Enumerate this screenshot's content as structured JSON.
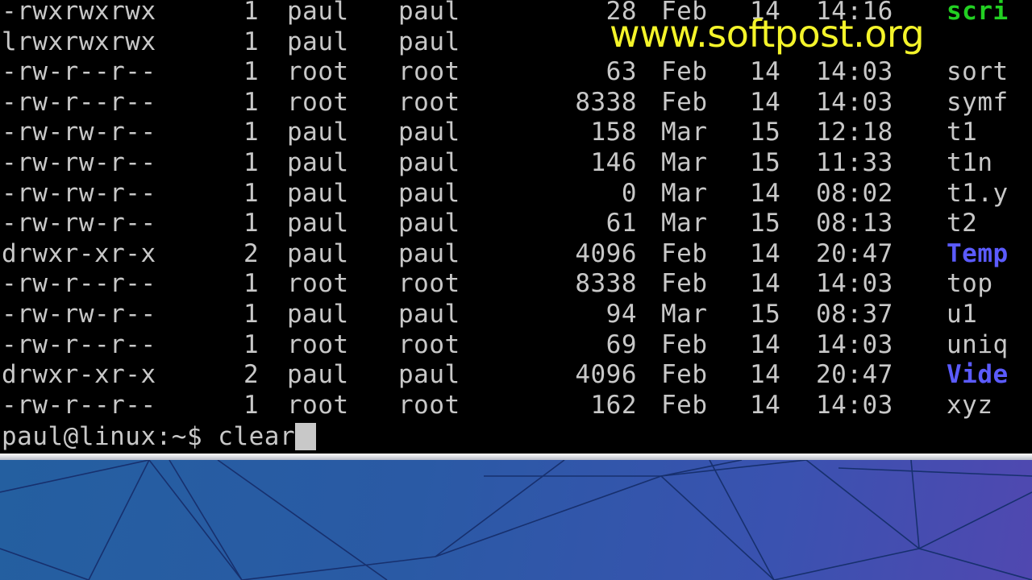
{
  "terminal": {
    "colors": {
      "background": "#000000",
      "text": "#c8c8c8",
      "executable": "#22d022",
      "directory": "#5b5bff",
      "cursor": "#c8c8c8"
    },
    "listing": [
      {
        "perms": "-rwxrwxrwx",
        "links": "1",
        "owner": "paul",
        "group": "paul",
        "size": "28",
        "month": "Feb",
        "day": "14",
        "time": "14:16",
        "name": "scri",
        "kind": "executable"
      },
      {
        "perms": "lrwxrwxrwx",
        "links": "1",
        "owner": "paul",
        "group": "paul",
        "size": "",
        "month": "",
        "day": "",
        "time": "",
        "name": "",
        "kind": "file"
      },
      {
        "perms": "-rw-r--r--",
        "links": "1",
        "owner": "root",
        "group": "root",
        "size": "63",
        "month": "Feb",
        "day": "14",
        "time": "14:03",
        "name": "sort",
        "kind": "file"
      },
      {
        "perms": "-rw-r--r--",
        "links": "1",
        "owner": "root",
        "group": "root",
        "size": "8338",
        "month": "Feb",
        "day": "14",
        "time": "14:03",
        "name": "symf",
        "kind": "file"
      },
      {
        "perms": "-rw-rw-r--",
        "links": "1",
        "owner": "paul",
        "group": "paul",
        "size": "158",
        "month": "Mar",
        "day": "15",
        "time": "12:18",
        "name": "t1",
        "kind": "file"
      },
      {
        "perms": "-rw-rw-r--",
        "links": "1",
        "owner": "paul",
        "group": "paul",
        "size": "146",
        "month": "Mar",
        "day": "15",
        "time": "11:33",
        "name": "t1n",
        "kind": "file"
      },
      {
        "perms": "-rw-rw-r--",
        "links": "1",
        "owner": "paul",
        "group": "paul",
        "size": "0",
        "month": "Mar",
        "day": "14",
        "time": "08:02",
        "name": "t1.y",
        "kind": "file"
      },
      {
        "perms": "-rw-rw-r--",
        "links": "1",
        "owner": "paul",
        "group": "paul",
        "size": "61",
        "month": "Mar",
        "day": "15",
        "time": "08:13",
        "name": "t2",
        "kind": "file"
      },
      {
        "perms": "drwxr-xr-x",
        "links": "2",
        "owner": "paul",
        "group": "paul",
        "size": "4096",
        "month": "Feb",
        "day": "14",
        "time": "20:47",
        "name": "Temp",
        "kind": "directory"
      },
      {
        "perms": "-rw-r--r--",
        "links": "1",
        "owner": "root",
        "group": "root",
        "size": "8338",
        "month": "Feb",
        "day": "14",
        "time": "14:03",
        "name": "top",
        "kind": "file"
      },
      {
        "perms": "-rw-rw-r--",
        "links": "1",
        "owner": "paul",
        "group": "paul",
        "size": "94",
        "month": "Mar",
        "day": "15",
        "time": "08:37",
        "name": "u1",
        "kind": "file"
      },
      {
        "perms": "-rw-r--r--",
        "links": "1",
        "owner": "root",
        "group": "root",
        "size": "69",
        "month": "Feb",
        "day": "14",
        "time": "14:03",
        "name": "uniq",
        "kind": "file"
      },
      {
        "perms": "drwxr-xr-x",
        "links": "2",
        "owner": "paul",
        "group": "paul",
        "size": "4096",
        "month": "Feb",
        "day": "14",
        "time": "20:47",
        "name": "Vide",
        "kind": "directory"
      },
      {
        "perms": "-rw-r--r--",
        "links": "1",
        "owner": "root",
        "group": "root",
        "size": "162",
        "month": "Feb",
        "day": "14",
        "time": "14:03",
        "name": "xyz",
        "kind": "file"
      }
    ],
    "prompt": "paul@linux:~$ ",
    "command": "clear"
  },
  "desktop": {
    "colors": {
      "wallpaper_left": "#245fa0",
      "wallpaper_right": "#5048b0",
      "lines": "#17306e"
    }
  },
  "watermark": {
    "text": "www.softpost.org",
    "color": "#f4f42a"
  }
}
